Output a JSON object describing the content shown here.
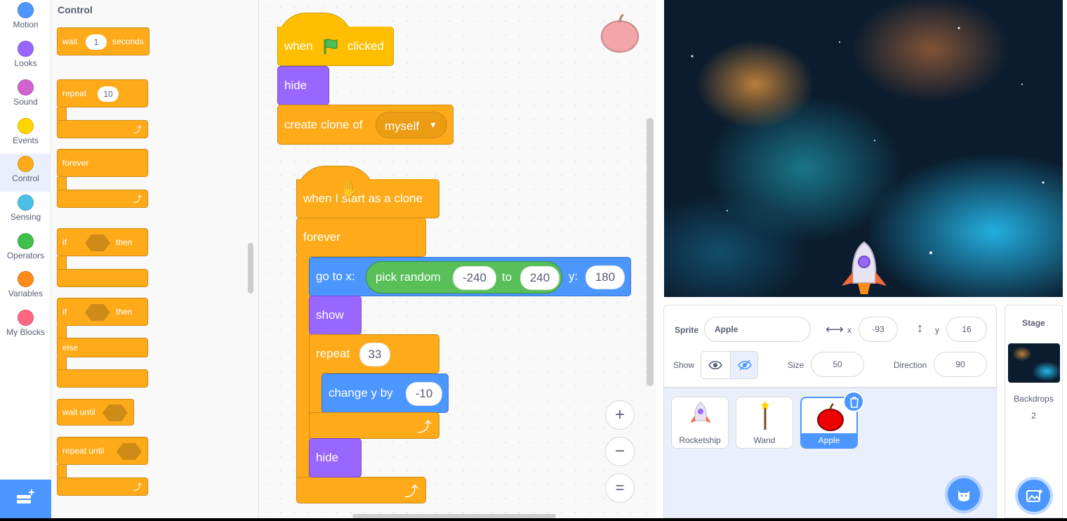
{
  "categories": [
    {
      "label": "Motion",
      "color": "#4c97ff"
    },
    {
      "label": "Looks",
      "color": "#9966ff"
    },
    {
      "label": "Sound",
      "color": "#cf63cf"
    },
    {
      "label": "Events",
      "color": "#ffd500"
    },
    {
      "label": "Control",
      "color": "#ffab19"
    },
    {
      "label": "Sensing",
      "color": "#4cbfe6"
    },
    {
      "label": "Operators",
      "color": "#40bf4a"
    },
    {
      "label": "Variables",
      "color": "#ff8c1a"
    },
    {
      "label": "My Blocks",
      "color": "#ff6680"
    }
  ],
  "selected_category": "Control",
  "palette": {
    "title": "Control",
    "wait_label": "wait",
    "wait_value": "1",
    "seconds_label": "seconds",
    "repeat_label": "repeat",
    "repeat_value": "10",
    "forever_label": "forever",
    "if_label": "if",
    "then_label": "then",
    "if2_label": "if",
    "then2_label": "then",
    "else_label": "else",
    "wait_until_label": "wait until",
    "repeat_until_label": "repeat until"
  },
  "script": {
    "when_label": "when",
    "clicked_label": "clicked",
    "hide1_label": "hide",
    "create_clone_label": "create clone of",
    "clone_target": "myself",
    "clone_hat_label": "when I start as a clone",
    "forever_label": "forever",
    "goto_label": "go to x:",
    "pick_random_label": "pick random",
    "random_from": "-240",
    "to_label": "to",
    "random_to": "240",
    "y_label": "y:",
    "y_value": "180",
    "show_label": "show",
    "repeat_label": "repeat",
    "repeat_value": "33",
    "change_y_label": "change y by",
    "change_y_value": "-10",
    "hide2_label": "hide"
  },
  "zoom": {
    "zoom_in": "+",
    "zoom_out": "−",
    "reset": "="
  },
  "sprite_info": {
    "sprite_label": "Sprite",
    "sprite_name": "Apple",
    "x_label": "x",
    "x_value": "-93",
    "y_label": "y",
    "y_value": "16",
    "show_label": "Show",
    "size_label": "Size",
    "size_value": "50",
    "direction_label": "Direction",
    "direction_value": "90"
  },
  "sprites": [
    {
      "name": "Rocketship"
    },
    {
      "name": "Wand"
    },
    {
      "name": "Apple"
    }
  ],
  "selected_sprite": "Apple",
  "stage_panel": {
    "title": "Stage",
    "backdrops_label": "Backdrops",
    "backdrops_count": "2"
  }
}
